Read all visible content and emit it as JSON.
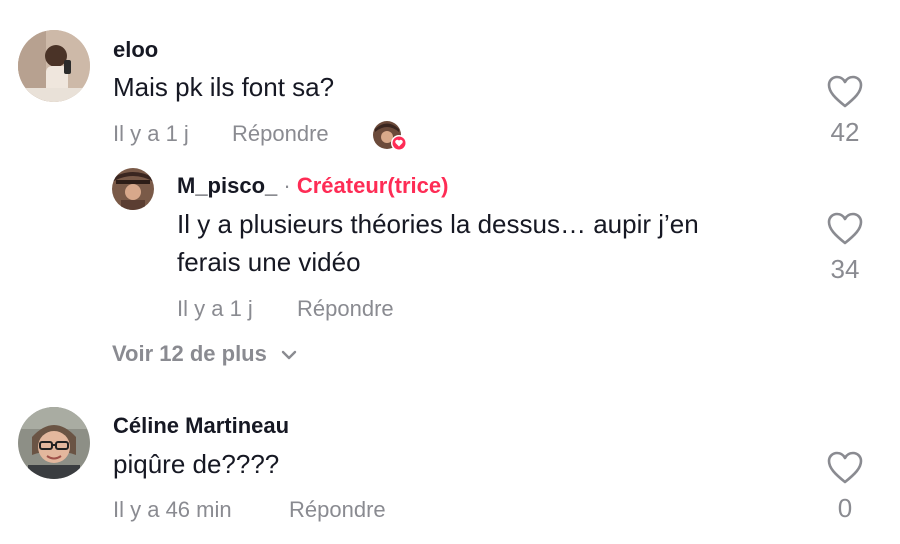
{
  "comments": [
    {
      "username": "eloo",
      "text": "Mais pk ils font sa?",
      "time": "Il y a 1 j",
      "reply_label": "Répondre",
      "likes": "42",
      "liked_by_creator": true,
      "replies": [
        {
          "username": "M_pisco_",
          "separator": "·",
          "badge": "Créateur(trice)",
          "text_line1": "Il y a plusieurs théories la dessus… aupir j’en",
          "text_line2": "ferais une vidéo",
          "time": "Il y a 1 j",
          "reply_label": "Répondre",
          "likes": "34"
        }
      ],
      "view_more": "Voir 12 de plus"
    },
    {
      "username": "Céline Martineau",
      "text": "piqûre de????",
      "time": "Il y a 46 min",
      "reply_label": "Répondre",
      "likes": "0"
    }
  ],
  "colors": {
    "accent": "#fe2c55",
    "muted": "#8a8b91",
    "text": "#161823"
  }
}
